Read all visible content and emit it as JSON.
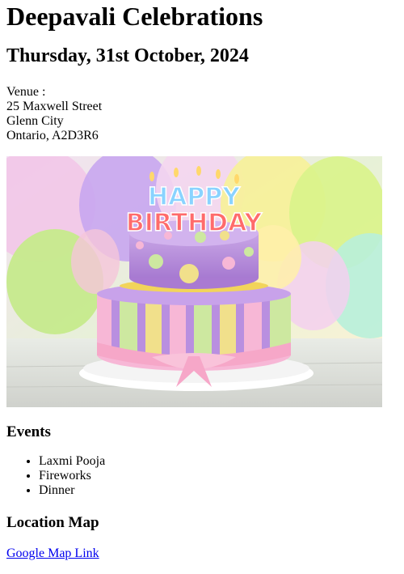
{
  "title": "Deepavali Celebrations",
  "date": "Thursday, 31st October, 2024",
  "venue": {
    "label": "Venue :",
    "lines": [
      "25 Maxwell Street",
      "Glenn City",
      "Ontario, A2D3R6"
    ]
  },
  "image": {
    "cake_text_line1": "HAPPY",
    "cake_text_line2": "BIRTHDAY"
  },
  "events": {
    "heading": "Events",
    "items": [
      "Laxmi Pooja",
      "Fireworks",
      "Dinner"
    ]
  },
  "location": {
    "heading": "Location Map",
    "link_text": "Google Map Link"
  },
  "colors": {
    "link": "#0000EE"
  }
}
